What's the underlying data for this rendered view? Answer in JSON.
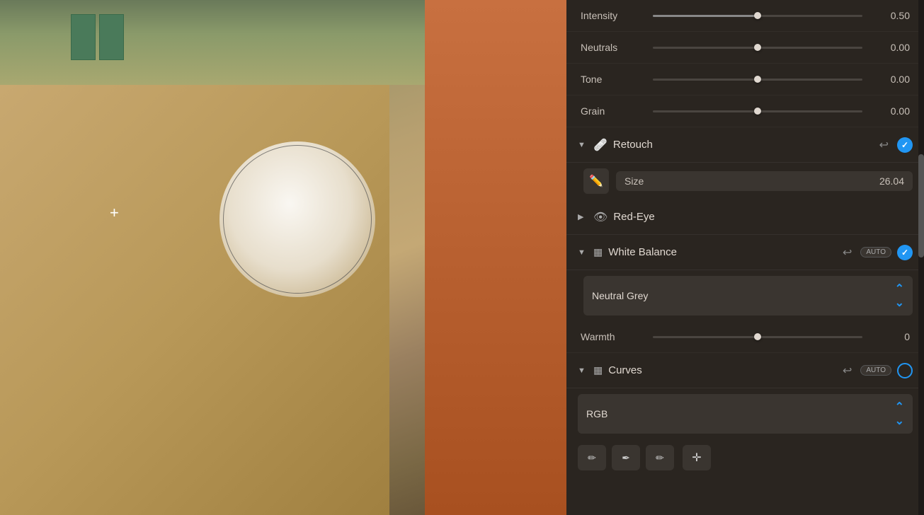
{
  "photo": {
    "alt": "Street building photo with retouch overlay"
  },
  "panel": {
    "sliders": [
      {
        "id": "intensity",
        "label": "Intensity",
        "value": "0.50",
        "percent": 50,
        "center": false
      },
      {
        "id": "neutrals",
        "label": "Neutrals",
        "value": "0.00",
        "percent": 50,
        "center": true
      },
      {
        "id": "tone",
        "label": "Tone",
        "value": "0.00",
        "percent": 50,
        "center": true
      },
      {
        "id": "grain",
        "label": "Grain",
        "value": "0.00",
        "percent": 50,
        "center": true
      }
    ],
    "retouch": {
      "title": "Retouch",
      "size_label": "Size",
      "size_value": "26.04",
      "tool_icon": "✏"
    },
    "red_eye": {
      "title": "Red-Eye"
    },
    "white_balance": {
      "title": "White Balance",
      "preset_label": "Neutral Grey",
      "warmth_label": "Warmth",
      "warmth_value": "0",
      "warmth_percent": 50
    },
    "curves": {
      "title": "Curves",
      "channel_label": "RGB",
      "tool1": "✏",
      "tool2": "✏",
      "tool3": "✏",
      "tool_plus": "✛"
    }
  }
}
